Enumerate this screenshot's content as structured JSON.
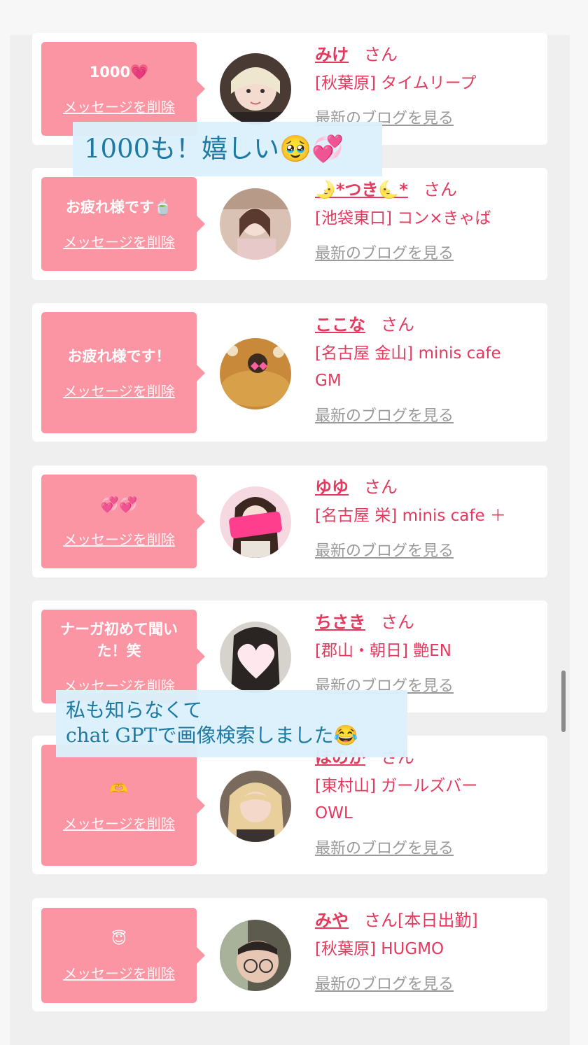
{
  "cards": [
    {
      "message": "1000💗",
      "delete_label": "メッセージを削除",
      "name": "みけ",
      "honorific": "さん",
      "extra": "",
      "shop": "[秋葉原] タイムリープ",
      "blog_label": "最新のブログを見る"
    },
    {
      "message": "お疲れ様です🍵",
      "delete_label": "メッセージを削除",
      "name": "🌛*つき🌜*",
      "honorific": "さん",
      "extra": "",
      "shop": "[池袋東口] コン×きゃば",
      "blog_label": "最新のブログを見る"
    },
    {
      "message": "お疲れ様です！",
      "delete_label": "メッセージを削除",
      "name": "ここな",
      "honorific": "さん",
      "extra": "",
      "shop": "[名古屋 金山] minis cafe GM",
      "blog_label": "最新のブログを見る"
    },
    {
      "message": "💞💞",
      "delete_label": "メッセージを削除",
      "name": "ゆゆ",
      "honorific": "さん",
      "extra": "",
      "shop": "[名古屋 栄] minis cafe ＋",
      "blog_label": "最新のブログを見る"
    },
    {
      "message": "ナーガ初めて聞いた！笑",
      "delete_label": "メッセージを削除",
      "name": "ちさき",
      "honorific": "さん",
      "extra": "",
      "shop": "[郡山・朝日] 艶EN",
      "blog_label": "最新のブログを見る"
    },
    {
      "message": "🫶",
      "delete_label": "メッセージを削除",
      "name": "ほのか",
      "honorific": "さん",
      "extra": "",
      "shop": "[東村山] ガールズバー OWL",
      "blog_label": "最新のブログを見る"
    },
    {
      "message": "😇",
      "delete_label": "メッセージを削除",
      "name": "みや",
      "honorific": "さん",
      "extra": "[本日出勤]",
      "shop": "[秋葉原] HUGMO",
      "blog_label": "最新のブログを見る"
    }
  ],
  "overlays": {
    "top": "1000も！嬉しい🥹💞",
    "bottom_line1": "私も知らなくて",
    "bottom_line2": "chat GPTで画像検索しました😂"
  }
}
